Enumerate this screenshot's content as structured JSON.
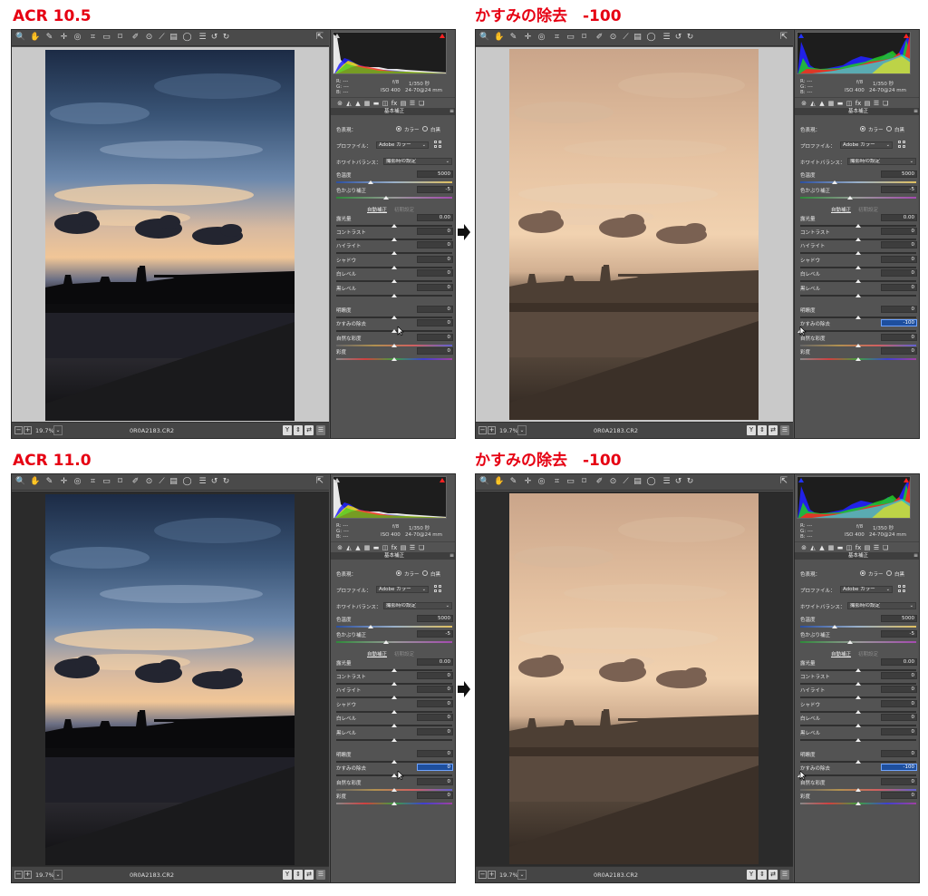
{
  "titles": [
    "ACR 10.5",
    "かすみの除去　-100",
    "ACR 11.0",
    "かすみの除去　-100"
  ],
  "windows": [
    {
      "id": "w1",
      "canvas_bg": "#c9c9c9",
      "photo": "original",
      "dehaze_value": "0",
      "dehaze_active": false,
      "dehaze_pos": 0.5,
      "hist": "orig"
    },
    {
      "id": "w2",
      "canvas_bg": "#c9c9c9",
      "photo": "hazy",
      "dehaze_value": "-100",
      "dehaze_active": true,
      "dehaze_pos": 0.0,
      "hist": "hazy"
    },
    {
      "id": "w3",
      "canvas_bg": "#2b2b2b",
      "photo": "original",
      "dehaze_value": "0",
      "dehaze_active": true,
      "dehaze_pos": 0.5,
      "hist": "orig"
    },
    {
      "id": "w4",
      "canvas_bg": "#2b2b2b",
      "photo": "hazy",
      "dehaze_value": "-100",
      "dehaze_active": true,
      "dehaze_pos": 0.0,
      "hist": "hazy"
    }
  ],
  "statusbar": {
    "zoom": "19.7%",
    "filename": "0R0A2183.CR2"
  },
  "rgb": {
    "r": "R:   ---",
    "g": "G:   ---",
    "b": "B:   ---"
  },
  "exif": {
    "aperture": "f/8",
    "shutter": "1/350 秒",
    "iso": "ISO 400",
    "lens": "24-70@24 mm"
  },
  "panel": {
    "section": "基本補正",
    "treatment_label": "色表現：",
    "treatment_color": "カラー",
    "treatment_bw": "白黒",
    "profile_label": "プロファイル：",
    "profile_value": "Adobe カラー",
    "wb_label": "ホワイトバランス：",
    "wb_value": "撮影時の設定",
    "temp_label": "色温度",
    "temp_value": "5000",
    "tint_label": "色かぶり補正",
    "tint_value": "-5",
    "auto": "自動補正",
    "default": "初期設定",
    "exposure_label": "露光量",
    "exposure_value": "0.00",
    "contrast_label": "コントラスト",
    "contrast_value": "0",
    "highlights_label": "ハイライト",
    "highlights_value": "0",
    "shadows_label": "シャドウ",
    "shadows_value": "0",
    "whites_label": "白レベル",
    "whites_value": "0",
    "blacks_label": "黒レベル",
    "blacks_value": "0",
    "clarity_label": "明瞭度",
    "clarity_value": "0",
    "dehaze_label": "かすみの除去",
    "vibrance_label": "自然な彩度",
    "vibrance_value": "0",
    "saturation_label": "彩度",
    "saturation_value": "0"
  }
}
